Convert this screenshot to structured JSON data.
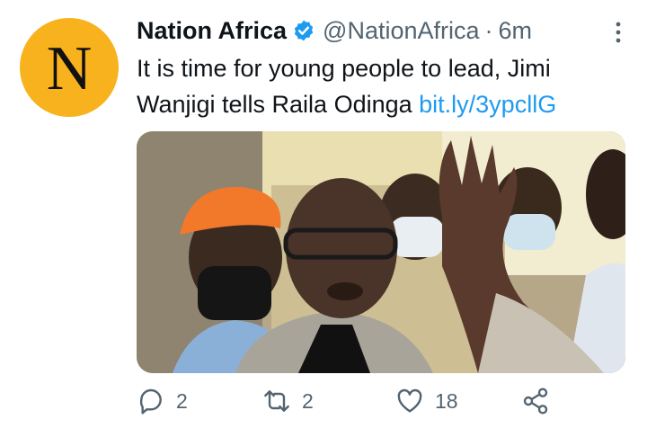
{
  "account": {
    "avatar_letter": "N",
    "name": "Nation Africa",
    "handle": "@NationAfrica",
    "separator": "·",
    "time": "6m"
  },
  "tweet": {
    "text": "It is time for young people to lead, Jimi Wanjigi tells Raila Odinga ",
    "link": "bit.ly/3ypcllG"
  },
  "actions": {
    "replies": "2",
    "retweets": "2",
    "likes": "18"
  },
  "colors": {
    "avatar_bg": "#f7b21d",
    "verified": "#1d9bf0",
    "link": "#1d9bf0",
    "muted": "#536471"
  },
  "icons": [
    "verified-badge-icon",
    "more-icon",
    "reply-icon",
    "retweet-icon",
    "like-icon",
    "share-icon"
  ]
}
